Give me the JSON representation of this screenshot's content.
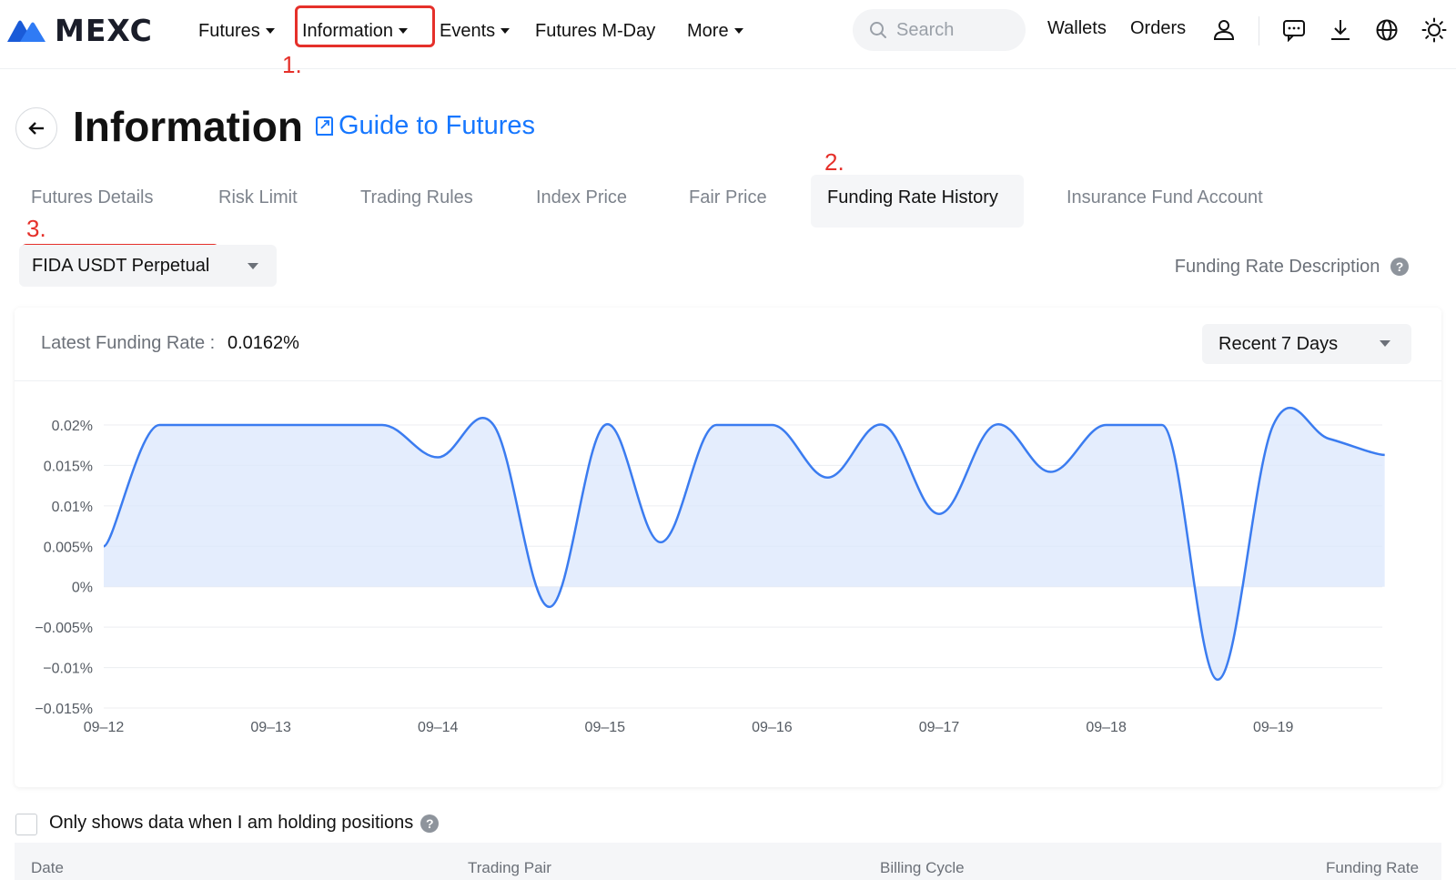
{
  "header": {
    "logo_text": "MEXC",
    "nav": [
      "Futures",
      "Information",
      "Events",
      "Futures M-Day",
      "More"
    ],
    "search_placeholder": "Search",
    "wallets": "Wallets",
    "orders": "Orders"
  },
  "annotations": [
    "1.",
    "2.",
    "3."
  ],
  "page": {
    "title": "Information",
    "guide_link": "Guide to Futures"
  },
  "tabs": [
    "Futures Details",
    "Risk Limit",
    "Trading Rules",
    "Index Price",
    "Fair Price",
    "Funding Rate History",
    "Insurance Fund Account"
  ],
  "active_tab": "Funding Rate History",
  "pair_select": "FIDA USDT Perpetual",
  "funding_rate_description": "Funding Rate Description",
  "latest": {
    "label": "Latest Funding Rate :",
    "value": "0.0162%"
  },
  "range_select": "Recent 7 Days",
  "chart_data": {
    "type": "area",
    "title": "",
    "xlabel": "",
    "ylabel": "",
    "ylim": [
      -0.015,
      0.02
    ],
    "y_ticks": [
      "0.02%",
      "0.015%",
      "0.01%",
      "0.005%",
      "0%",
      "−0.005%",
      "−0.01%",
      "−0.015%"
    ],
    "x_ticks": [
      "09–12",
      "09–13",
      "09–14",
      "09–15",
      "09–16",
      "09–17",
      "09–18",
      "09–19"
    ],
    "grid": true,
    "line_color": "#3b7cf0",
    "fill_color": "#dbe7fc",
    "x_unit": "days from 09-12 00:00",
    "points": [
      [
        0.0,
        0.005
      ],
      [
        0.333,
        0.02
      ],
      [
        0.667,
        0.02
      ],
      [
        1.0,
        0.02
      ],
      [
        1.333,
        0.02
      ],
      [
        1.667,
        0.02
      ],
      [
        2.0,
        0.016
      ],
      [
        2.333,
        0.02
      ],
      [
        2.667,
        -0.0025
      ],
      [
        3.0,
        0.02
      ],
      [
        3.333,
        0.0055
      ],
      [
        3.667,
        0.02
      ],
      [
        4.0,
        0.02
      ],
      [
        4.333,
        0.0135
      ],
      [
        4.667,
        0.02
      ],
      [
        5.0,
        0.009
      ],
      [
        5.333,
        0.02
      ],
      [
        5.667,
        0.0142
      ],
      [
        6.0,
        0.02
      ],
      [
        6.333,
        0.02
      ],
      [
        6.667,
        -0.0115
      ],
      [
        7.0,
        0.02
      ],
      [
        7.333,
        0.0183
      ],
      [
        7.667,
        0.0163
      ]
    ]
  },
  "holding_filter": "Only shows data when I am holding positions",
  "table": {
    "columns": [
      "Date",
      "Trading Pair",
      "Billing Cycle",
      "Funding Rate"
    ]
  },
  "colors": {
    "accent": "#1677ff",
    "annotation": "#e5302a",
    "chart_line": "#3b7cf0"
  }
}
